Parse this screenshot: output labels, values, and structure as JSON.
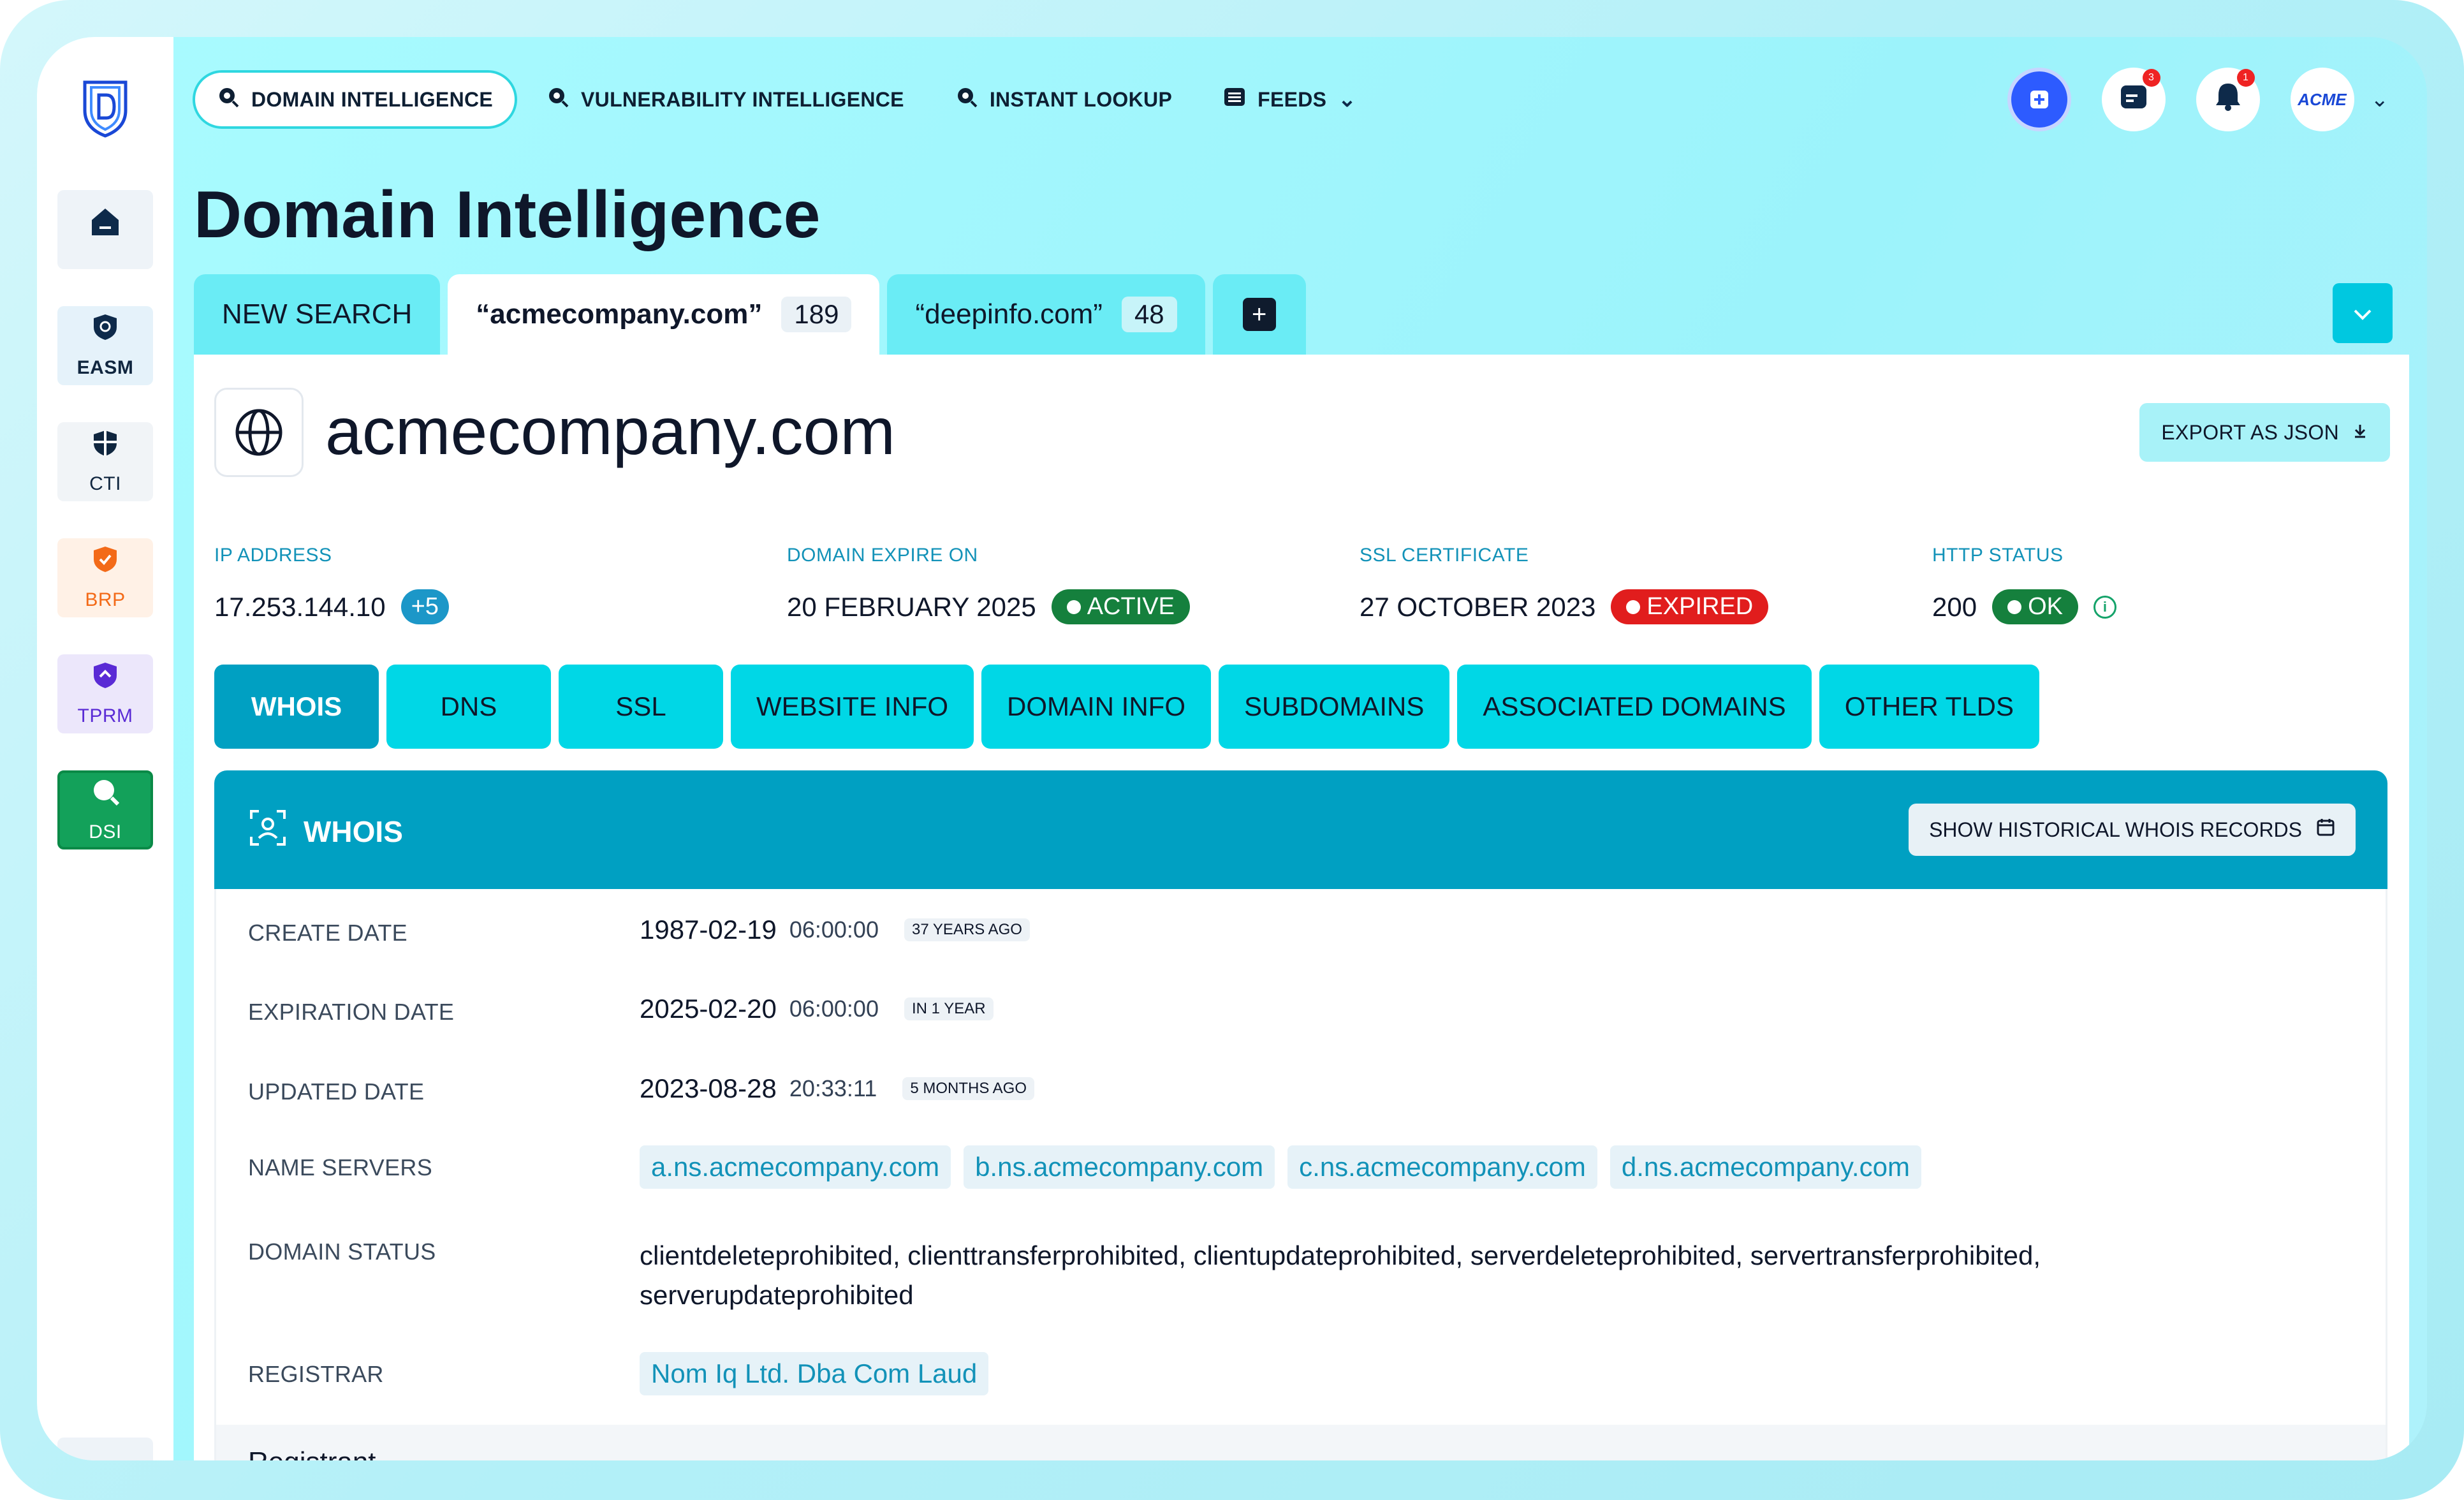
{
  "nav": {
    "items": [
      {
        "label": "DOMAIN INTELLIGENCE",
        "icon": "search-icon",
        "active": true
      },
      {
        "label": "VULNERABILITY INTELLIGENCE",
        "icon": "search-icon"
      },
      {
        "label": "INSTANT LOOKUP",
        "icon": "search-icon"
      },
      {
        "label": "FEEDS",
        "icon": "feed-icon"
      }
    ],
    "messages_badge": "3",
    "notifications_badge": "1",
    "avatar_text": "ACME"
  },
  "sidebar": {
    "items": [
      {
        "label": "",
        "icon": "home-icon"
      },
      {
        "label": "EASM",
        "icon": "shield-icon"
      },
      {
        "label": "CTI",
        "icon": "shield-icon"
      },
      {
        "label": "BRP",
        "icon": "shield-check-icon"
      },
      {
        "label": "TPRM",
        "icon": "shield-icon"
      },
      {
        "label": "DSI",
        "icon": "search-icon",
        "active": true
      }
    ]
  },
  "page_title": "Domain Intelligence",
  "tabs": {
    "new_search": "NEW SEARCH",
    "items": [
      {
        "label": "“acmecompany.com”",
        "count": "189",
        "active": true
      },
      {
        "label": "“deepinfo.com”",
        "count": "48"
      }
    ],
    "add": "+"
  },
  "domain": {
    "name": "acmecompany.com",
    "export_label": "EXPORT AS JSON"
  },
  "meta": {
    "ip": {
      "label": "IP ADDRESS",
      "value": "17.253.144.10",
      "extra": "+5"
    },
    "expire": {
      "label": "DOMAIN EXPIRE ON",
      "value": "20 FEBRUARY 2025",
      "status": "ACTIVE"
    },
    "ssl": {
      "label": "SSL CERTIFICATE",
      "value": "27 OCTOBER 2023",
      "status": "EXPIRED"
    },
    "http": {
      "label": "HTTP STATUS",
      "value": "200",
      "status": "OK"
    }
  },
  "subtabs": [
    "WHOIS",
    "DNS",
    "SSL",
    "WEBSITE INFO",
    "DOMAIN INFO",
    "SUBDOMAINS",
    "ASSOCIATED DOMAINS",
    "OTHER TLDS"
  ],
  "whois": {
    "title": "WHOIS",
    "history_button": "SHOW HISTORICAL WHOIS RECORDS",
    "create": {
      "label": "CREATE DATE",
      "date": "1987-02-19",
      "time": "06:00:00",
      "ago": "37 YEARS AGO"
    },
    "expiration": {
      "label": "EXPIRATION DATE",
      "date": "2025-02-20",
      "time": "06:00:00",
      "ago": "IN 1 YEAR"
    },
    "updated": {
      "label": "UPDATED DATE",
      "date": "2023-08-28",
      "time": "20:33:11",
      "ago": "5 MONTHS AGO"
    },
    "name_servers": {
      "label": "NAME SERVERS",
      "values": [
        "a.ns.acmecompany.com",
        "b.ns.acmecompany.com",
        "c.ns.acmecompany.com",
        "d.ns.acmecompany.com"
      ]
    },
    "domain_status": {
      "label": "DOMAIN STATUS",
      "value": "clientdeleteprohibited, clienttransferprohibited, clientupdateprohibited, serverdeleteprohibited, servertransferprohibited, serverupdateprohibited"
    },
    "registrar": {
      "label": "REGISTRAR",
      "value": "Nom Iq Ltd. Dba Com Laud"
    },
    "registrant_heading": "Registrant"
  },
  "colors": {
    "accent": "#00a0c2",
    "tab_cyan": "#00d7e6",
    "active_green": "#15803d",
    "expired_red": "#e11d1d",
    "dsi_green": "#13a15a"
  }
}
